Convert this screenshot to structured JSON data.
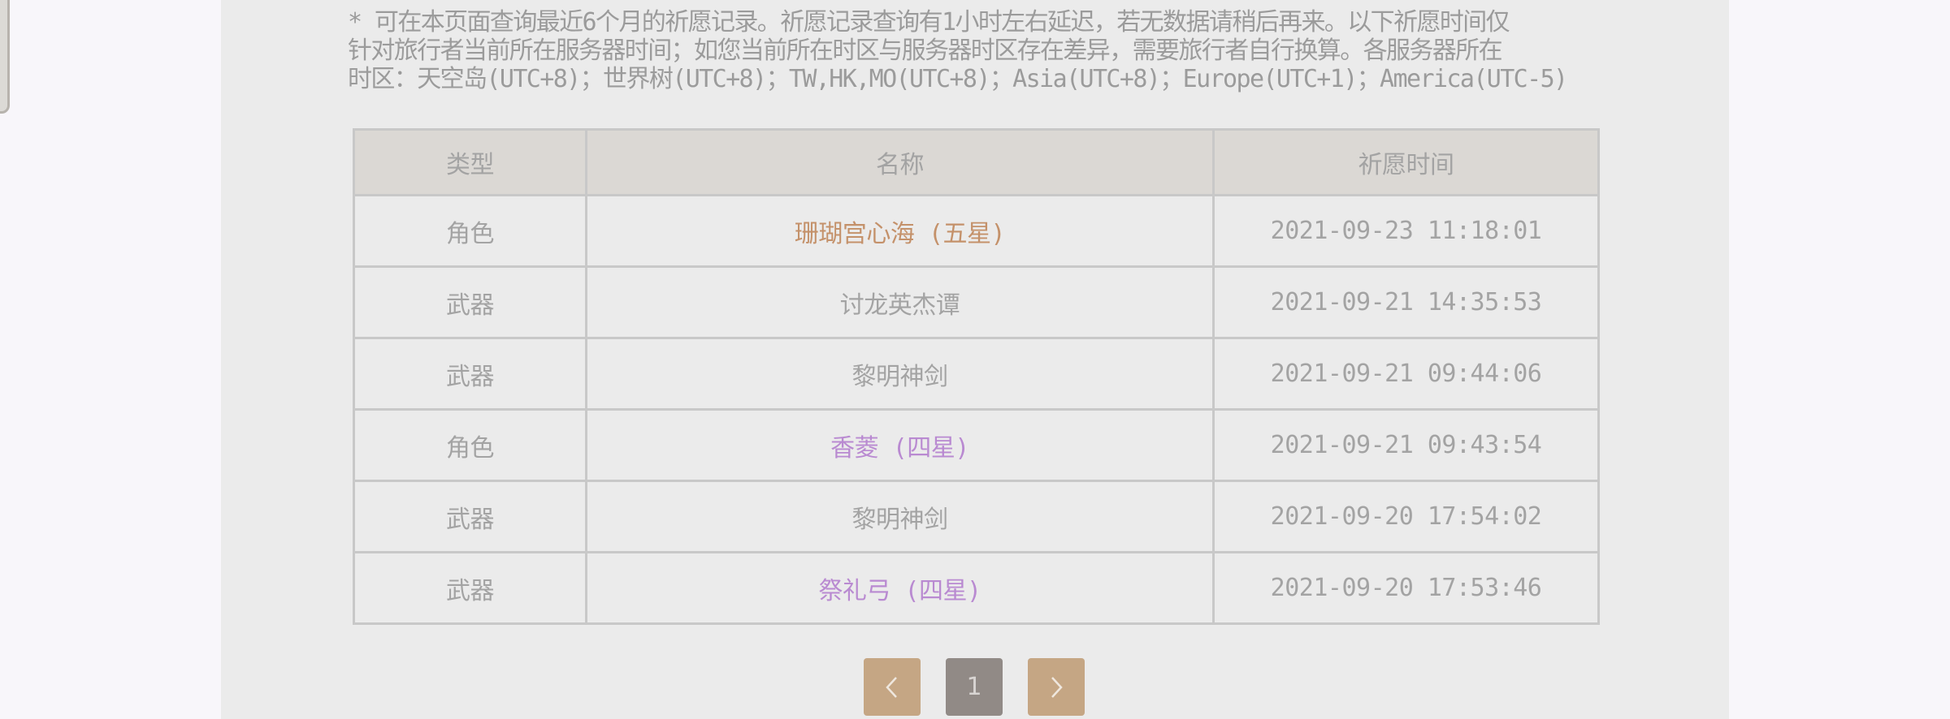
{
  "notice": {
    "line1": "* 可在本页面查询最近6个月的祈愿记录。祈愿记录查询有1小时左右延迟，若无数据请稍后再来。以下祈愿时间仅",
    "line2": "针对旅行者当前所在服务器时间；如您当前所在时区与服务器时区存在差异，需要旅行者自行换算。各服务器所在",
    "line3": "时区：天空岛(UTC+8)；世界树(UTC+8)；TW,HK,MO(UTC+8)；Asia(UTC+8)；Europe(UTC+1)；America(UTC-5)"
  },
  "table": {
    "headers": {
      "type": "类型",
      "name": "名称",
      "time": "祈愿时间"
    },
    "rows": [
      {
        "type": "角色",
        "name": "珊瑚宫心海 (五星)",
        "time": "2021-09-23 11:18:01",
        "rarity": "five"
      },
      {
        "type": "武器",
        "name": "讨龙英杰谭",
        "time": "2021-09-21 14:35:53",
        "rarity": "three"
      },
      {
        "type": "武器",
        "name": "黎明神剑",
        "time": "2021-09-21 09:44:06",
        "rarity": "three"
      },
      {
        "type": "角色",
        "name": "香菱 (四星)",
        "time": "2021-09-21 09:43:54",
        "rarity": "four"
      },
      {
        "type": "武器",
        "name": "黎明神剑",
        "time": "2021-09-20 17:54:02",
        "rarity": "three"
      },
      {
        "type": "武器",
        "name": "祭礼弓 (四星)",
        "time": "2021-09-20 17:53:46",
        "rarity": "four"
      }
    ]
  },
  "pager": {
    "prev_icon": "chevron-left-icon",
    "current_page": "1",
    "next_icon": "chevron-right-icon"
  },
  "colors": {
    "five_star": "#c4916a",
    "four_star": "#b98ad1",
    "nav_button": "#c5a684",
    "current_page_button": "#918a86"
  }
}
